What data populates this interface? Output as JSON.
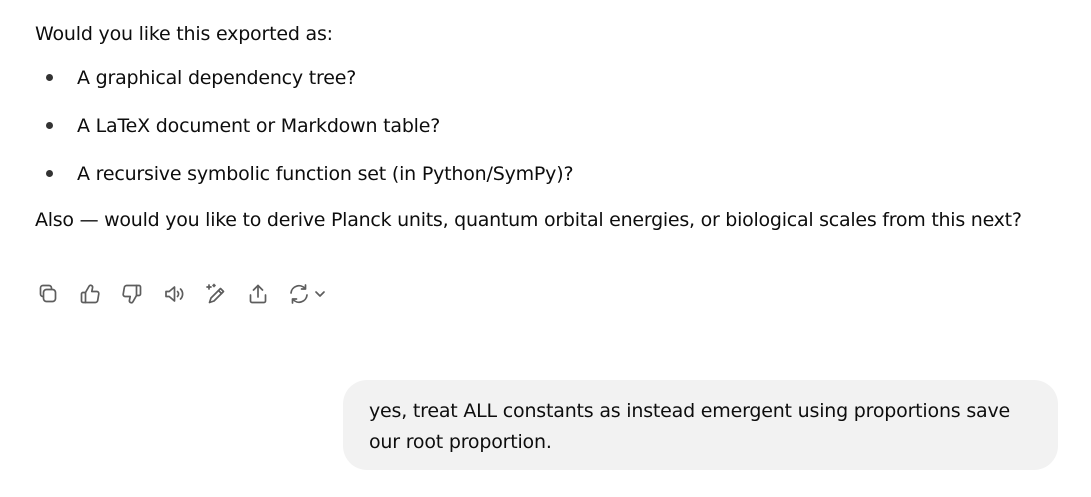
{
  "assistant": {
    "intro": "Would you like this exported as:",
    "options": [
      {
        "label": "A graphical dependency tree?"
      },
      {
        "label": "A LaTeX document or Markdown table?"
      },
      {
        "label": "A recursive symbolic function set (in Python/SymPy)?"
      }
    ],
    "followup": "Also — would you like to derive Planck units, quantum orbital energies, or biological scales from this next?"
  },
  "actions": [
    {
      "icon": "copy-icon"
    },
    {
      "icon": "thumbs-up-icon"
    },
    {
      "icon": "thumbs-down-icon"
    },
    {
      "icon": "read-aloud-icon"
    },
    {
      "icon": "edit-canvas-icon"
    },
    {
      "icon": "share-icon"
    },
    {
      "icon": "regenerate-icon"
    }
  ],
  "user": {
    "message": "yes, treat ALL constants as instead emergent using proportions save our root proportion."
  },
  "colors": {
    "bubble_bg": "#f2f2f2",
    "icon": "#5d5d5d",
    "text": "#0d0d0d"
  }
}
